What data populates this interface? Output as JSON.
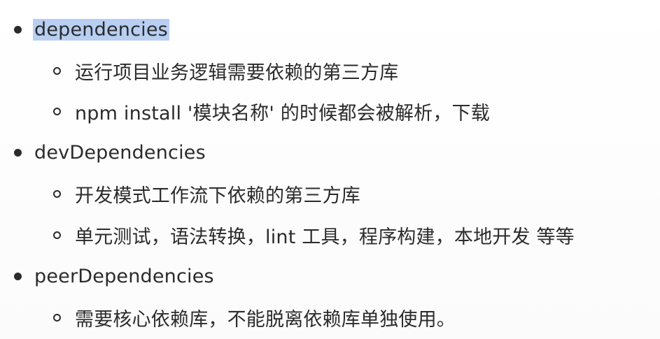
{
  "items": [
    {
      "term": "dependencies",
      "highlighted": true,
      "subitems": [
        "运行项目业务逻辑需要依赖的第三方库",
        "npm install '模块名称' 的时候都会被解析，下载"
      ]
    },
    {
      "term": "devDependencies",
      "highlighted": false,
      "subitems": [
        "开发模式工作流下依赖的第三方库",
        "单元测试，语法转换，lint 工具，程序构建，本地开发 等等"
      ]
    },
    {
      "term": "peerDependencies",
      "highlighted": false,
      "subitems": [
        "需要核心依赖库，不能脱离依赖库单独使用。"
      ]
    }
  ],
  "colors": {
    "text": "#2b2b2b",
    "highlight": "#b8cff3",
    "background": "#ffffff"
  }
}
